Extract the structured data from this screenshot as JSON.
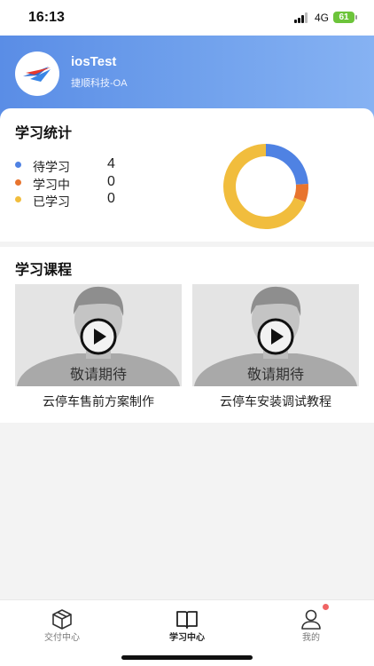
{
  "status_bar": {
    "time": "16:13",
    "network": "4G",
    "battery": "61"
  },
  "header": {
    "username": "iosTest",
    "company": "捷顺科技-OA"
  },
  "stats": {
    "title": "学习统计",
    "items": [
      {
        "label": "待学习",
        "value": "4",
        "color": "#4f82e3"
      },
      {
        "label": "学习中",
        "value": "0",
        "color": "#e8742e"
      },
      {
        "label": "已学习",
        "value": "0",
        "color": "#f1bd3d"
      }
    ]
  },
  "chart_data": {
    "type": "pie",
    "style": "donut",
    "slices": [
      {
        "color": "#4f82e3",
        "value": 24
      },
      {
        "color": "#e8742e",
        "value": 7
      },
      {
        "color": "#f1bd3d",
        "value": 69
      }
    ]
  },
  "courses": {
    "title": "学习课程",
    "items": [
      {
        "thumb_label": "敬请期待",
        "title": "云停车售前方案制作"
      },
      {
        "thumb_label": "敬请期待",
        "title": "云停车安装调试教程"
      }
    ]
  },
  "tabbar": {
    "items": [
      {
        "label": "交付中心",
        "icon": "box-icon"
      },
      {
        "label": "学习中心",
        "icon": "book-icon",
        "active": true
      },
      {
        "label": "我的",
        "icon": "user-icon",
        "badge": true
      }
    ]
  }
}
